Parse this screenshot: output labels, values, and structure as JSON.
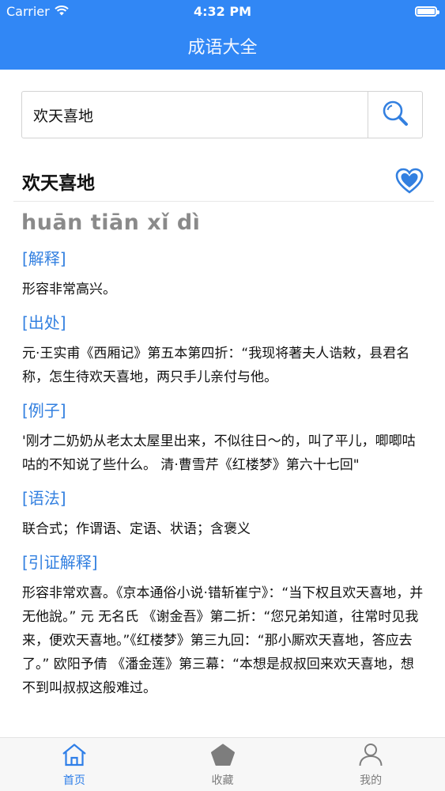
{
  "status_bar": {
    "carrier": "Carrier",
    "time": "4:32 PM"
  },
  "nav": {
    "title": "成语大全"
  },
  "search": {
    "value": "欢天喜地",
    "button_icon": "search-icon"
  },
  "idiom": {
    "title": "欢天喜地",
    "pinyin": "huān tiān xǐ dì",
    "favorite_icon": "heart-icon"
  },
  "sections": [
    {
      "heading": "[解释]",
      "body": "形容非常高兴。"
    },
    {
      "heading": "[出处]",
      "body": "元·王实甫《西厢记》第五本第四折：“我现将著夫人诰敕，县君名称，怎生待欢天喜地，两只手儿亲付与他。"
    },
    {
      "heading": "[例子]",
      "body": "'刚才二奶奶从老太太屋里出来，不似往日～的，叫了平儿，唧唧咕咕的不知说了些什么。 清·曹雪芹《红楼梦》第六十七回\""
    },
    {
      "heading": "[语法]",
      "body": "联合式；作谓语、定语、状语；含褒义"
    },
    {
      "heading": "[引证解释]",
      "body": "形容非常欢喜。《京本通俗小说·错斩崔宁》：“当下权且欢天喜地，并无他說。” 元 无名氏 《谢金吾》第二折：“您兄弟知道，往常时见我来，便欢天喜地。”《红楼梦》第三九回：“那小厮欢天喜地，答应去了。” 欧阳予倩 《潘金莲》第三幕：“本想是叔叔回来欢天喜地，想不到叫叔叔这般难过。"
    }
  ],
  "tabs": [
    {
      "label": "首页",
      "icon": "home-icon",
      "active": true
    },
    {
      "label": "收藏",
      "icon": "pentagon-icon",
      "active": false
    },
    {
      "label": "我的",
      "icon": "person-icon",
      "active": false
    }
  ],
  "colors": {
    "nav_bar": "#3187f5",
    "accent": "#3380e0",
    "pinyin": "#8a8a8a",
    "tab_inactive": "#7d7d7d"
  }
}
